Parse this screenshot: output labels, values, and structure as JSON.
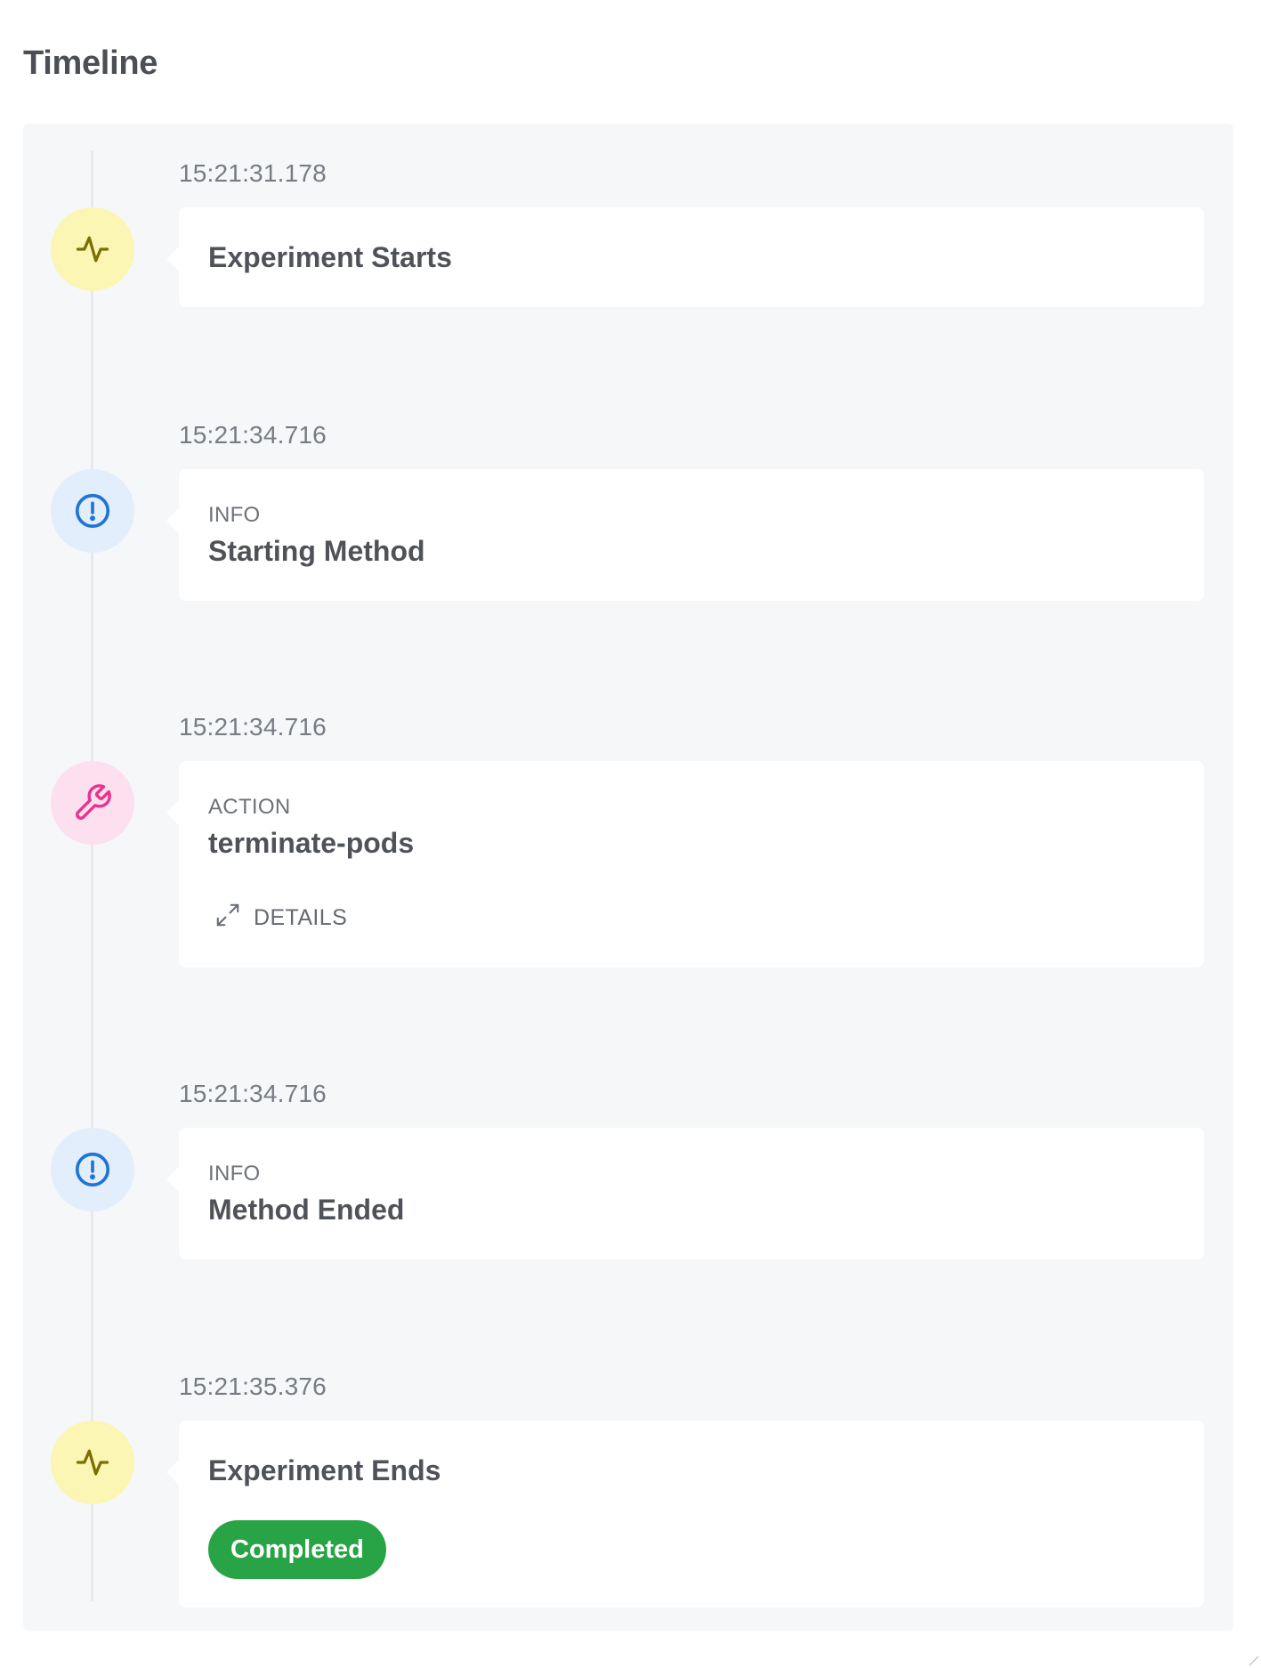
{
  "page": {
    "title": "Timeline"
  },
  "colors": {
    "panel_background": "#f6f7f9",
    "rail": "#e7e9ec",
    "marker_yellow_bg": "#fbf6b3",
    "marker_yellow_icon": "#7a6f00",
    "marker_blue_bg": "#e2eefc",
    "marker_blue_icon": "#1f74d6",
    "marker_pink_bg": "#fde0ef",
    "marker_pink_icon": "#e8348f",
    "status_completed": "#28a447"
  },
  "timeline": {
    "events": [
      {
        "time": "15:21:31.178",
        "icon": "activity-pulse-icon",
        "kind": "",
        "heading": "Experiment Starts"
      },
      {
        "time": "15:21:34.716",
        "icon": "info-alert-icon",
        "kind": "INFO",
        "heading": "Starting Method"
      },
      {
        "time": "15:21:34.716",
        "icon": "wrench-icon",
        "kind": "ACTION",
        "heading": "terminate-pods",
        "details_label": "DETAILS"
      },
      {
        "time": "15:21:34.716",
        "icon": "info-alert-icon",
        "kind": "INFO",
        "heading": "Method Ended"
      },
      {
        "time": "15:21:35.376",
        "icon": "activity-pulse-icon",
        "kind": "",
        "heading": "Experiment Ends",
        "status": "Completed"
      }
    ]
  }
}
